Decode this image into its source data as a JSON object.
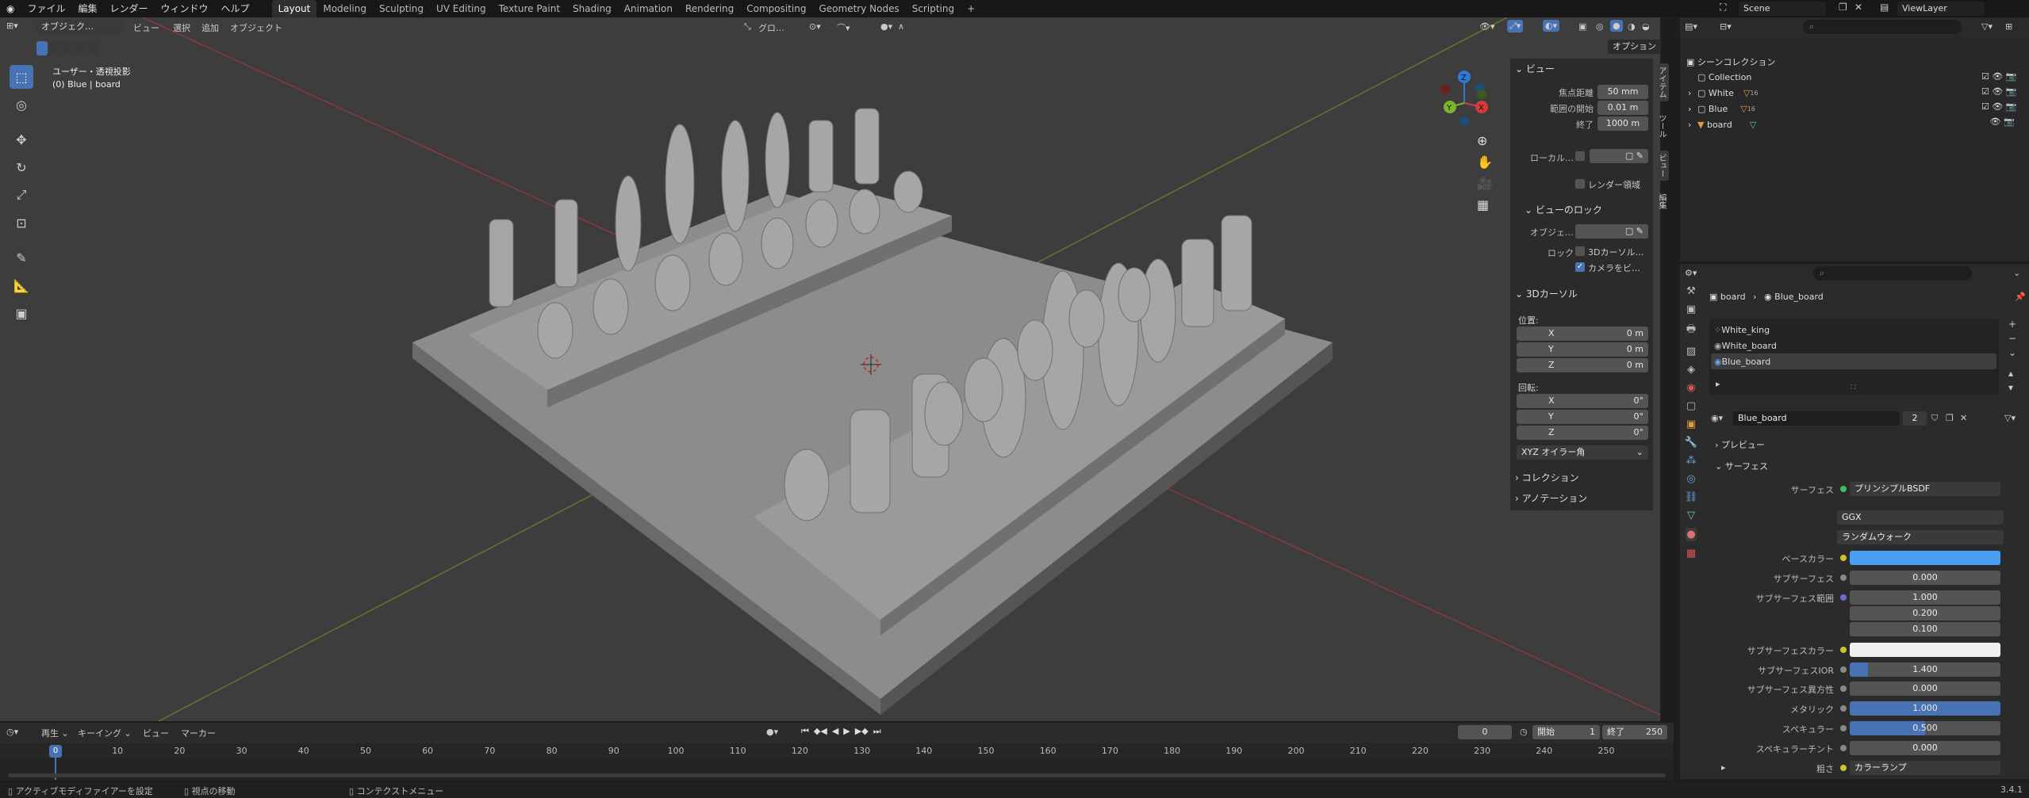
{
  "topbar": {
    "menus": [
      "ファイル",
      "編集",
      "レンダー",
      "ウィンドウ",
      "ヘルプ"
    ],
    "workspaces": [
      "Layout",
      "Modeling",
      "Sculpting",
      "UV Editing",
      "Texture Paint",
      "Shading",
      "Animation",
      "Rendering",
      "Compositing",
      "Geometry Nodes",
      "Scripting"
    ],
    "add_tab": "+",
    "scene": "Scene",
    "view_layer": "ViewLayer"
  },
  "viewport_header": {
    "mode": "オブジェク…",
    "menus": [
      "ビュー",
      "選択",
      "追加",
      "オブジェクト"
    ],
    "orientation": "グロ…",
    "options": "オプション"
  },
  "viewport": {
    "view_name": "ユーザー・透視投影",
    "object_info": "(0) Blue | board"
  },
  "npanel": {
    "view_title": "ビュー",
    "focal_label": "焦点距離",
    "focal_value": "50 mm",
    "clip_start_label": "範囲の開始",
    "clip_start_value": "0.01 m",
    "clip_end_label": "終了",
    "clip_end_value": "1000 m",
    "local_label": "ローカル…",
    "render_region": "レンダー領域",
    "view_lock_title": "ビューのロック",
    "lock_object_label": "オブジェ…",
    "lock_label": "ロック",
    "lock_cursor": "3Dカーソル…",
    "lock_camera": "カメラをビ…",
    "cursor_title": "3Dカーソル",
    "location_label": "位置:",
    "x": "X",
    "y": "Y",
    "z": "Z",
    "loc_x": "0 m",
    "loc_y": "0 m",
    "loc_z": "0 m",
    "rotation_label": "回転:",
    "rot_x": "0°",
    "rot_y": "0°",
    "rot_z": "0°",
    "rotation_mode": "XYZ オイラー角",
    "collection_title": "コレクション",
    "annotation_title": "アノテーション",
    "tabs": [
      "アイテム",
      "ツール",
      "ビュー",
      "編集"
    ]
  },
  "outliner": {
    "root": "シーンコレクション",
    "items": [
      {
        "name": "Collection",
        "badge": ""
      },
      {
        "name": "White",
        "badge": "16"
      },
      {
        "name": "Blue",
        "badge": "16"
      },
      {
        "name": "board",
        "badge": ""
      }
    ]
  },
  "properties": {
    "breadcrumb_object": "board",
    "breadcrumb_material": "Blue_board",
    "slots": [
      "White_king",
      "White_board",
      "Blue_board"
    ],
    "material_name": "Blue_board",
    "users": "2",
    "preview_title": "プレビュー",
    "surface_title": "サーフェス",
    "rows": [
      {
        "label": "サーフェス",
        "value": "プリンシプルBSDF",
        "dot": "green"
      },
      {
        "label": "",
        "value": "GGX",
        "dot": ""
      },
      {
        "label": "",
        "value": "ランダムウォーク",
        "dot": ""
      },
      {
        "label": "ベースカラー",
        "value": "",
        "dot": "yellow"
      },
      {
        "label": "サブサーフェス",
        "value": "0.000",
        "dot": "grey"
      },
      {
        "label": "サブサーフェス範囲",
        "value": "1.000",
        "dot": "purple"
      },
      {
        "label": "",
        "value": "0.200",
        "dot": ""
      },
      {
        "label": "",
        "value": "0.100",
        "dot": ""
      },
      {
        "label": "サブサーフェスカラー",
        "value": "",
        "dot": "yellow"
      },
      {
        "label": "サブサーフェスIOR",
        "value": "1.400",
        "dot": "grey"
      },
      {
        "label": "サブサーフェス異方性",
        "value": "0.000",
        "dot": "grey"
      },
      {
        "label": "メタリック",
        "value": "1.000",
        "dot": "grey"
      },
      {
        "label": "スペキュラー",
        "value": "0.500",
        "dot": "grey"
      },
      {
        "label": "スペキュラーチント",
        "value": "0.000",
        "dot": "grey"
      },
      {
        "label": "粗さ",
        "value": "カラーランプ",
        "dot": "yellow"
      }
    ],
    "base_color": "#4a9ff5",
    "subsurface_color": "#f0f0f0"
  },
  "timeline": {
    "menus": [
      "再生",
      "キーイング",
      "ビュー",
      "マーカー"
    ],
    "current_frame": "0",
    "start_label": "開始",
    "start_value": "1",
    "end_label": "終了",
    "end_value": "250",
    "ticks": [
      "0",
      "10",
      "20",
      "30",
      "40",
      "50",
      "60",
      "70",
      "80",
      "90",
      "100",
      "110",
      "120",
      "130",
      "140",
      "150",
      "160",
      "170",
      "180",
      "190",
      "200",
      "210",
      "220",
      "230",
      "240",
      "250"
    ],
    "playhead": "0"
  },
  "statusbar": {
    "hint1": "アクティブモディファイアーを設定",
    "hint2": "視点の移動",
    "hint3": "コンテクストメニュー",
    "version": "3.4.1"
  }
}
